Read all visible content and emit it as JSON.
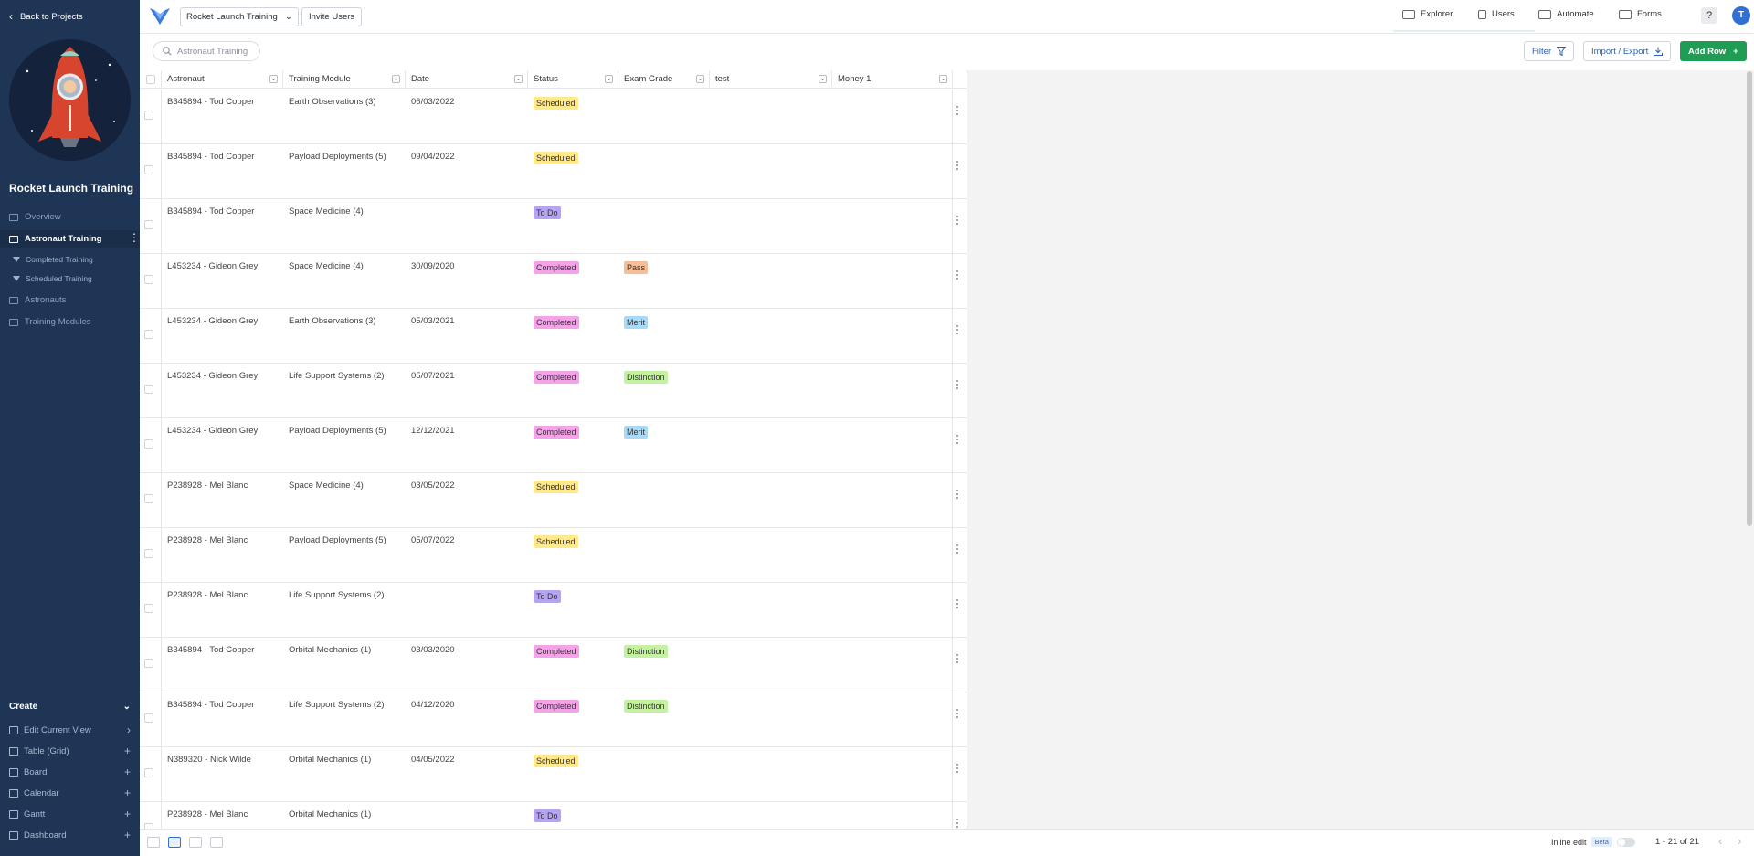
{
  "sidebar": {
    "back_label": "Back to Projects",
    "project_title": "Rocket Launch Training",
    "nav": [
      {
        "label": "Overview"
      },
      {
        "label": "Astronaut Training"
      },
      {
        "label": "Astronauts"
      },
      {
        "label": "Training Modules"
      }
    ],
    "subviews": [
      {
        "label": "Completed Training"
      },
      {
        "label": "Scheduled Training"
      }
    ],
    "create": {
      "header": "Create",
      "items": [
        {
          "label": "Edit Current View"
        },
        {
          "label": "Table (Grid)"
        },
        {
          "label": "Board"
        },
        {
          "label": "Calendar"
        },
        {
          "label": "Gantt"
        },
        {
          "label": "Dashboard"
        }
      ]
    }
  },
  "topbar": {
    "project_select": "Rocket Launch Training",
    "invite_label": "Invite Users",
    "nav": [
      {
        "label": "Explorer"
      },
      {
        "label": "Users"
      },
      {
        "label": "Automate"
      },
      {
        "label": "Forms"
      }
    ],
    "help": "?",
    "user_initial": "T"
  },
  "toolbar": {
    "search_placeholder": "Astronaut Training",
    "filter_label": "Filter",
    "import_label": "Import / Export",
    "add_row_label": "Add Row"
  },
  "table": {
    "columns": [
      "Astronaut",
      "Training Module",
      "Date",
      "Status",
      "Exam Grade",
      "test",
      "Money 1"
    ],
    "rows": [
      {
        "astronaut": "B345894 - Tod Copper",
        "module": "Earth Observations (3)",
        "date": "06/03/2022",
        "status": "Scheduled",
        "grade": ""
      },
      {
        "astronaut": "B345894 - Tod Copper",
        "module": "Payload Deployments (5)",
        "date": "09/04/2022",
        "status": "Scheduled",
        "grade": ""
      },
      {
        "astronaut": "B345894 - Tod Copper",
        "module": "Space Medicine (4)",
        "date": "",
        "status": "To Do",
        "grade": ""
      },
      {
        "astronaut": "L453234 - Gideon Grey",
        "module": "Space Medicine (4)",
        "date": "30/09/2020",
        "status": "Completed",
        "grade": "Pass"
      },
      {
        "astronaut": "L453234 - Gideon Grey",
        "module": "Earth Observations (3)",
        "date": "05/03/2021",
        "status": "Completed",
        "grade": "Merit"
      },
      {
        "astronaut": "L453234 - Gideon Grey",
        "module": "Life Support Systems (2)",
        "date": "05/07/2021",
        "status": "Completed",
        "grade": "Distinction"
      },
      {
        "astronaut": "L453234 - Gideon Grey",
        "module": "Payload Deployments (5)",
        "date": "12/12/2021",
        "status": "Completed",
        "grade": "Merit"
      },
      {
        "astronaut": "P238928 - Mel Blanc",
        "module": "Space Medicine (4)",
        "date": "03/05/2022",
        "status": "Scheduled",
        "grade": ""
      },
      {
        "astronaut": "P238928 - Mel Blanc",
        "module": "Payload Deployments (5)",
        "date": "05/07/2022",
        "status": "Scheduled",
        "grade": ""
      },
      {
        "astronaut": "P238928 - Mel Blanc",
        "module": "Life Support Systems (2)",
        "date": "",
        "status": "To Do",
        "grade": ""
      },
      {
        "astronaut": "B345894 - Tod Copper",
        "module": "Orbital Mechanics (1)",
        "date": "03/03/2020",
        "status": "Completed",
        "grade": "Distinction"
      },
      {
        "astronaut": "B345894 - Tod Copper",
        "module": "Life Support Systems (2)",
        "date": "04/12/2020",
        "status": "Completed",
        "grade": "Distinction"
      },
      {
        "astronaut": "N389320 - Nick Wilde",
        "module": "Orbital Mechanics (1)",
        "date": "04/05/2022",
        "status": "Scheduled",
        "grade": ""
      },
      {
        "astronaut": "P238928 - Mel Blanc",
        "module": "Orbital Mechanics (1)",
        "date": "",
        "status": "To Do",
        "grade": ""
      }
    ]
  },
  "footer": {
    "inline_edit": "Inline edit",
    "beta": "Beta",
    "pagination": "1 - 21 of 21"
  },
  "colors": {
    "sidebar_bg": "#1e3556",
    "add_row_bg": "#1f9d55",
    "accent_blue": "#2f6fd6",
    "status_scheduled": "#ffe98a",
    "status_todo": "#b6a4f3",
    "status_completed": "#f5a3e9",
    "grade_pass": "#f7bd97",
    "grade_merit": "#a8daf7",
    "grade_distinction": "#c5f2a0"
  }
}
